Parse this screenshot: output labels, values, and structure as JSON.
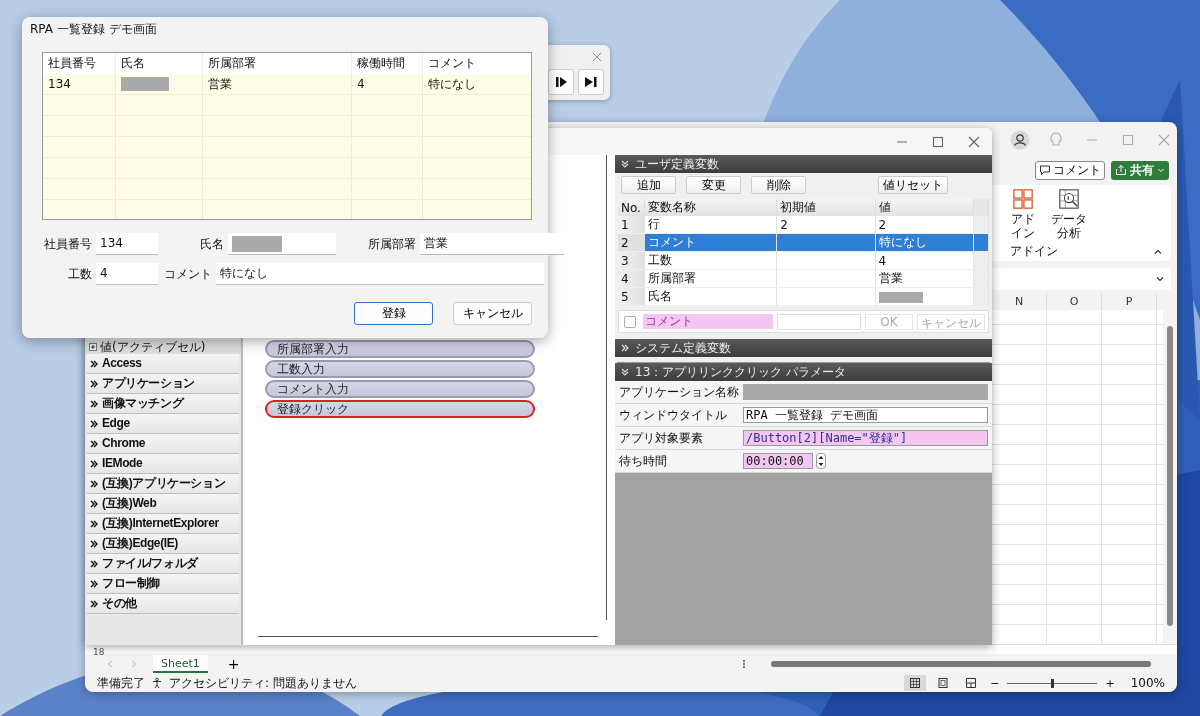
{
  "dialog": {
    "title": "RPA 一覧登録 デモ画面",
    "table": {
      "columns": [
        "社員番号",
        "氏名",
        "所属部署",
        "稼働時間",
        "コメント"
      ],
      "rows": [
        {
          "employee_no": "134",
          "name_redacted": true,
          "department": "営業",
          "hours": "4",
          "comment": "特になし"
        }
      ]
    },
    "fields": [
      {
        "label": "社員番号",
        "value": "134"
      },
      {
        "label": "氏名",
        "redacted": true
      },
      {
        "label": "所属部署",
        "value": "営業"
      },
      {
        "label": "工数",
        "value": "4"
      },
      {
        "label": "コメント",
        "value": "特になし"
      }
    ],
    "buttons": [
      {
        "label": "登録",
        "default": true
      },
      {
        "label": "キャンセル",
        "default": false
      }
    ]
  },
  "rpa": {
    "palette": {
      "top_item": "値(アクティブセル)",
      "items": [
        "Access",
        "アプリケーション",
        "画像マッチング",
        "Edge",
        "Chrome",
        "IEMode",
        "(互換)アプリケーション",
        "(互換)Web",
        "(互換)InternetExplorer",
        "(互換)Edge(IE)",
        "ファイル/フォルダ",
        "フロー制御",
        "その他"
      ]
    },
    "flow": [
      {
        "label": "所属部署入力",
        "selected": false
      },
      {
        "label": "工数入力",
        "selected": false
      },
      {
        "label": "コメント入力",
        "selected": false
      },
      {
        "label": "登録クリック",
        "selected": true
      }
    ],
    "user_vars": {
      "title": "ユーザ定義変数",
      "expanded": true,
      "buttons": [
        "追加",
        "変更",
        "削除",
        "値リセット"
      ],
      "columns": [
        "No.",
        "変数名称",
        "初期値",
        "値"
      ],
      "rows": [
        {
          "no": "1",
          "name": "行",
          "initial": "2",
          "value": "2",
          "selected": false
        },
        {
          "no": "2",
          "name": "コメント",
          "value": "特になし",
          "selected": true
        },
        {
          "no": "3",
          "name": "工数",
          "value": "4",
          "selected": false
        },
        {
          "no": "4",
          "name": "所属部署",
          "value": "営業",
          "selected": false
        },
        {
          "no": "5",
          "name": "氏名",
          "value_redacted": true,
          "selected": false
        }
      ],
      "editor": {
        "checked": false,
        "name": "コメント",
        "ok": "OK",
        "cancel": "キャンセル",
        "disabled": true
      }
    },
    "system_vars": {
      "title": "システム定義変数",
      "expanded": false
    },
    "params": {
      "title": "13：アプリリンククリック パラメータ",
      "expanded": true,
      "fields": [
        {
          "label": "アプリケーション名称",
          "kind": "disabled"
        },
        {
          "label": "ウィンドウタイトル",
          "kind": "text",
          "value": "RPA 一覧登録 デモ画面"
        },
        {
          "label": "アプリ対象要素",
          "kind": "highlight",
          "value": "/Button[2][Name=\"登録\"]"
        },
        {
          "label": "待ち時間",
          "kind": "time",
          "value": "00:00:00"
        }
      ]
    }
  },
  "excel": {
    "comment_button": "コメント",
    "share_button": "共有",
    "ribbon": {
      "items": [
        {
          "label": "アドイン",
          "kind": "addin"
        },
        {
          "label": "データ分析",
          "kind": "analysis"
        }
      ],
      "group_label": "アドイン"
    },
    "columns": [
      "N",
      "O",
      "P"
    ],
    "row_header": "18",
    "sheet_tabs": [
      {
        "label": "Sheet1",
        "selected": true
      }
    ],
    "add_sheet": "+",
    "status": {
      "ready": "準備完了",
      "accessibility": "アクセシビリティ: 問題ありません",
      "views": [
        {
          "kind": "normal",
          "selected": true
        },
        {
          "kind": "page",
          "selected": false
        },
        {
          "kind": "break",
          "selected": false
        }
      ],
      "zoom_minus": "−",
      "zoom_plus": "+",
      "zoom_slider": {
        "level": 0.5
      },
      "zoom": "100%"
    }
  }
}
